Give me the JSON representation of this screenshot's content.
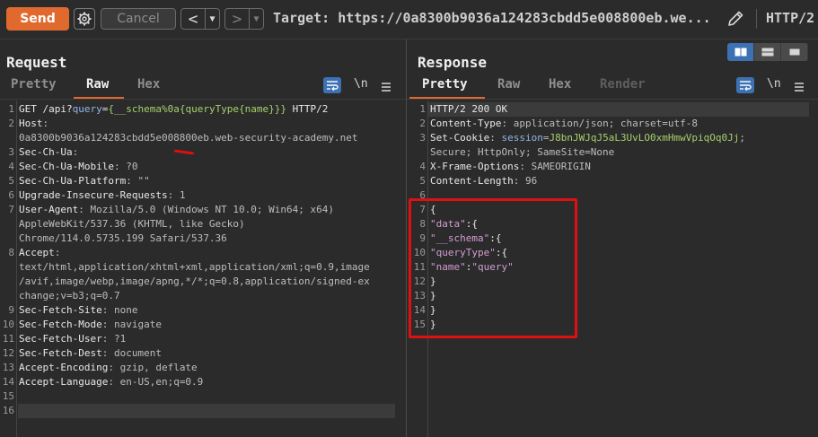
{
  "toolbar": {
    "send_label": "Send",
    "cancel_label": "Cancel",
    "target_text": "Target: https://0a8300b9036a124283cbdd5e008800eb.we...",
    "protocol": "HTTP/2"
  },
  "request": {
    "title": "Request",
    "tabs": [
      "Pretty",
      "Raw",
      "Hex"
    ],
    "active_tab": "Raw",
    "newline_toggle": "\\n",
    "lines": [
      {
        "n": "1",
        "parts": [
          [
            "GET /api?",
            "k"
          ],
          [
            "query",
            "blu"
          ],
          [
            "=",
            "k"
          ],
          [
            "{__schema%0a{queryType{name}}}",
            "grn"
          ],
          [
            " HTTP/2",
            "k"
          ]
        ]
      },
      {
        "n": "2",
        "parts": [
          [
            "Host",
            "k"
          ],
          [
            ":",
            "v"
          ]
        ]
      },
      {
        "n": "",
        "parts": [
          [
            "0a8300b9036a124283cbdd5e008800eb.web-security-academy.net",
            "v"
          ]
        ]
      },
      {
        "n": "3",
        "parts": [
          [
            "Sec-Ch-Ua",
            "k"
          ],
          [
            ":",
            "v"
          ]
        ]
      },
      {
        "n": "4",
        "parts": [
          [
            "Sec-Ch-Ua-Mobile",
            "k"
          ],
          [
            ": ?0",
            "v"
          ]
        ]
      },
      {
        "n": "5",
        "parts": [
          [
            "Sec-Ch-Ua-Platform",
            "k"
          ],
          [
            ": \"\"",
            "v"
          ]
        ]
      },
      {
        "n": "6",
        "parts": [
          [
            "Upgrade-Insecure-Requests",
            "k"
          ],
          [
            ": 1",
            "v"
          ]
        ]
      },
      {
        "n": "7",
        "parts": [
          [
            "User-Agent",
            "k"
          ],
          [
            ": Mozilla/5.0 (Windows NT 10.0; Win64; x64)",
            "v"
          ]
        ]
      },
      {
        "n": "",
        "parts": [
          [
            "AppleWebKit/537.36 (KHTML, like Gecko)",
            "v"
          ]
        ]
      },
      {
        "n": "",
        "parts": [
          [
            "Chrome/114.0.5735.199 Safari/537.36",
            "v"
          ]
        ]
      },
      {
        "n": "8",
        "parts": [
          [
            "Accept",
            "k"
          ],
          [
            ":",
            "v"
          ]
        ]
      },
      {
        "n": "",
        "parts": [
          [
            "text/html,application/xhtml+xml,application/xml;q=0.9,image",
            "v"
          ]
        ]
      },
      {
        "n": "",
        "parts": [
          [
            "/avif,image/webp,image/apng,*/*;q=0.8,application/signed-ex",
            "v"
          ]
        ]
      },
      {
        "n": "",
        "parts": [
          [
            "change;v=b3;q=0.7",
            "v"
          ]
        ]
      },
      {
        "n": "9",
        "parts": [
          [
            "Sec-Fetch-Site",
            "k"
          ],
          [
            ": none",
            "v"
          ]
        ]
      },
      {
        "n": "10",
        "parts": [
          [
            "Sec-Fetch-Mode",
            "k"
          ],
          [
            ": navigate",
            "v"
          ]
        ]
      },
      {
        "n": "11",
        "parts": [
          [
            "Sec-Fetch-User",
            "k"
          ],
          [
            ": ?1",
            "v"
          ]
        ]
      },
      {
        "n": "12",
        "parts": [
          [
            "Sec-Fetch-Dest",
            "k"
          ],
          [
            ": document",
            "v"
          ]
        ]
      },
      {
        "n": "13",
        "parts": [
          [
            "Accept-Encoding",
            "k"
          ],
          [
            ": gzip, deflate",
            "v"
          ]
        ]
      },
      {
        "n": "14",
        "parts": [
          [
            "Accept-Language",
            "k"
          ],
          [
            ": en-US,en;q=0.9",
            "v"
          ]
        ]
      },
      {
        "n": "15",
        "parts": []
      },
      {
        "n": "16",
        "parts": []
      }
    ]
  },
  "response": {
    "title": "Response",
    "tabs": [
      "Pretty",
      "Raw",
      "Hex",
      "Render"
    ],
    "active_tab": "Pretty",
    "newline_toggle": "\\n",
    "lines": [
      {
        "n": "1",
        "parts": [
          [
            "HTTP/2 200 OK",
            "k"
          ]
        ]
      },
      {
        "n": "2",
        "parts": [
          [
            "Content-Type",
            "k"
          ],
          [
            ": application/json; charset=utf-8",
            "v"
          ]
        ]
      },
      {
        "n": "3",
        "parts": [
          [
            "Set-Cookie",
            "k"
          ],
          [
            ": ",
            "v"
          ],
          [
            "session",
            "blu"
          ],
          [
            "=",
            "v"
          ],
          [
            "J8bnJWJqJ5aL3UvLO0xmHmwVpiqOq0Jj",
            "grn"
          ],
          [
            ";",
            "v"
          ]
        ]
      },
      {
        "n": "",
        "parts": [
          [
            "Secure; HttpOnly; SameSite=None",
            "v"
          ]
        ]
      },
      {
        "n": "4",
        "parts": [
          [
            "X-Frame-Options",
            "k"
          ],
          [
            ": SAMEORIGIN",
            "v"
          ]
        ]
      },
      {
        "n": "5",
        "parts": [
          [
            "Content-Length",
            "k"
          ],
          [
            ": 96",
            "v"
          ]
        ]
      },
      {
        "n": "6",
        "parts": []
      },
      {
        "n": "7",
        "parts": [
          [
            "{",
            "k"
          ]
        ]
      },
      {
        "n": "8",
        "parts": [
          [
            "  ",
            "k"
          ],
          [
            "\"data\"",
            "str"
          ],
          [
            ":{",
            "k"
          ]
        ]
      },
      {
        "n": "9",
        "parts": [
          [
            "    ",
            "k"
          ],
          [
            "\"__schema\"",
            "str"
          ],
          [
            ":{",
            "k"
          ]
        ]
      },
      {
        "n": "10",
        "parts": [
          [
            "      ",
            "k"
          ],
          [
            "\"queryType\"",
            "str"
          ],
          [
            ":{",
            "k"
          ]
        ]
      },
      {
        "n": "11",
        "parts": [
          [
            "        ",
            "k"
          ],
          [
            "\"name\"",
            "str"
          ],
          [
            ":",
            "k"
          ],
          [
            "\"query\"",
            "str"
          ]
        ]
      },
      {
        "n": "12",
        "parts": [
          [
            "      }",
            "k"
          ]
        ]
      },
      {
        "n": "13",
        "parts": [
          [
            "    }",
            "k"
          ]
        ]
      },
      {
        "n": "14",
        "parts": [
          [
            "  }",
            "k"
          ]
        ]
      },
      {
        "n": "15",
        "parts": [
          [
            "}",
            "k"
          ]
        ]
      }
    ]
  },
  "colors": {
    "accent": "#e06a2e",
    "highlight_box": "#e01010",
    "toggle_blue": "#3c72b3"
  }
}
